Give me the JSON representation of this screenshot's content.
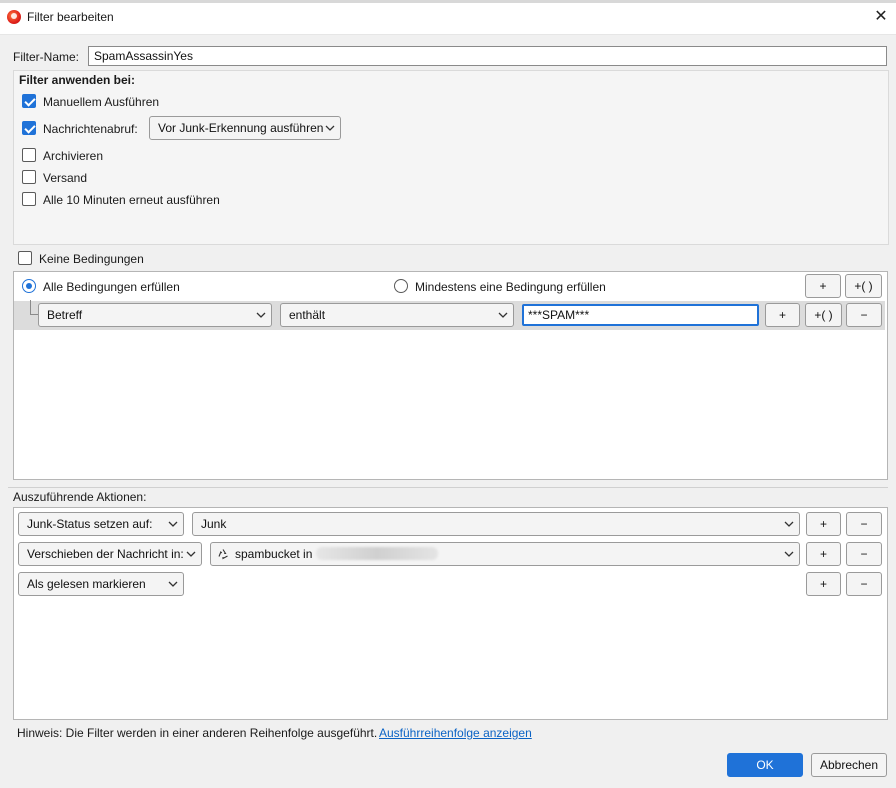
{
  "window": {
    "title": "Filter bearbeiten"
  },
  "filter_name": {
    "label": "Filter-Name:",
    "value": "SpamAssassinYes"
  },
  "apply": {
    "heading": "Filter anwenden bei:",
    "manual": {
      "label": "Manuellem Ausführen",
      "checked": true
    },
    "fetch": {
      "label": "Nachrichtenabruf:",
      "checked": true,
      "option": "Vor Junk-Erkennung ausführen"
    },
    "archive": {
      "label": "Archivieren",
      "checked": false
    },
    "send": {
      "label": "Versand",
      "checked": false
    },
    "periodic": {
      "label": "Alle 10 Minuten erneut ausführen",
      "checked": false
    }
  },
  "conditions": {
    "no_conditions": {
      "label": "Keine Bedingungen",
      "checked": false
    },
    "match_all": {
      "label": "Alle Bedingungen erfüllen",
      "selected": true
    },
    "match_any": {
      "label": "Mindestens eine Bedingung erfüllen",
      "selected": false
    },
    "add_label": "+",
    "add_group_label": "+( )",
    "rows": [
      {
        "field": "Betreff",
        "operator": "enthält",
        "value": "***SPAM***",
        "add": "+",
        "add_group": "+( )",
        "remove": "−"
      }
    ]
  },
  "actions": {
    "heading": "Auszuführende Aktionen:",
    "rows": [
      {
        "action": "Junk-Status setzen auf:",
        "target": "Junk",
        "add": "+",
        "remove": "−"
      },
      {
        "action": "Verschieben der Nachricht in:",
        "target": "spambucket in",
        "target_icon": "folder-recycle-icon",
        "add": "+",
        "remove": "−"
      },
      {
        "action": "Als gelesen markieren",
        "add": "+",
        "remove": "−"
      }
    ]
  },
  "footer": {
    "hint": "Hinweis: Die Filter werden in einer anderen Reihenfolge ausgeführt.",
    "hint_link": "Ausführreihenfolge anzeigen",
    "ok": "OK",
    "cancel": "Abbrechen"
  },
  "colors": {
    "accent": "#1f72d8",
    "link": "#0b63c5"
  }
}
